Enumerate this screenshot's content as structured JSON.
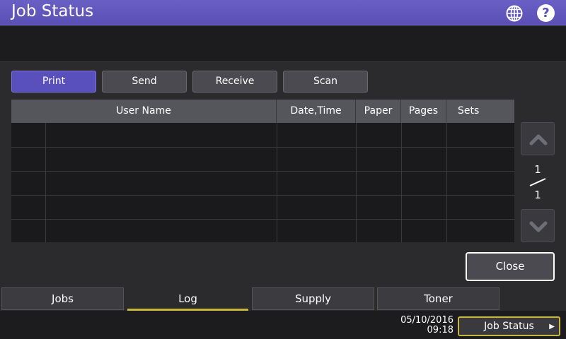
{
  "window": {
    "title": "Job Status"
  },
  "header_icons": {
    "globe": "globe-icon",
    "help": "help-icon",
    "help_glyph": "?"
  },
  "job_tabs": [
    {
      "label": "Print",
      "active": true
    },
    {
      "label": "Send",
      "active": false
    },
    {
      "label": "Receive",
      "active": false
    },
    {
      "label": "Scan",
      "active": false
    }
  ],
  "table": {
    "columns": [
      "",
      "User Name",
      "Date,Time",
      "Paper",
      "Pages",
      "Sets"
    ],
    "rows": []
  },
  "pager": {
    "current": "1",
    "total": "1"
  },
  "buttons": {
    "close": "Close"
  },
  "bottom_tabs": [
    {
      "label": "Jobs",
      "active": false
    },
    {
      "label": "Log",
      "active": true
    },
    {
      "label": "Supply",
      "active": false
    },
    {
      "label": "Toner",
      "active": false
    }
  ],
  "footer": {
    "date": "05/10/2016",
    "time": "09:18",
    "job_status_label": "Job Status"
  },
  "colors": {
    "accent": "#5a50bd",
    "highlight": "#c9b63c"
  }
}
